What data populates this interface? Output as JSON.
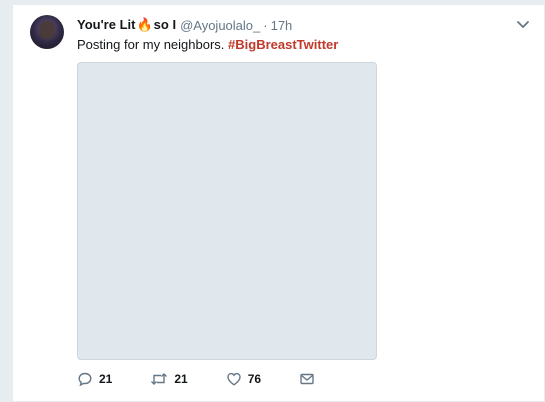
{
  "tweet": {
    "display_name": "You're Lit",
    "display_name_suffix": "so I",
    "handle": "@Ayojuolalo_",
    "separator": "·",
    "time": "17h",
    "text": "Posting for my neighbors.",
    "hashtag": "#BigBreastTwitter"
  },
  "actions": {
    "replies": "21",
    "retweets": "21",
    "likes": "76"
  },
  "icons": {
    "name_emoji": "fire-icon",
    "menu": "chevron-down-icon",
    "reply": "reply-icon",
    "retweet": "retweet-icon",
    "like": "heart-icon",
    "dm": "envelope-icon"
  },
  "colors": {
    "hashtag": "#c0392b",
    "icon_gray": "#657786",
    "fire": "#f4900c"
  }
}
